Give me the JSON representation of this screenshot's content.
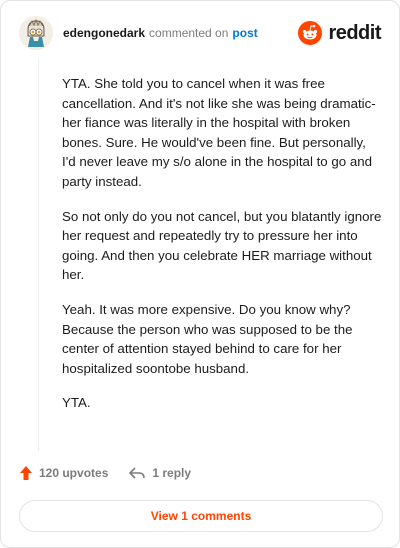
{
  "comment": {
    "username": "edengonedark",
    "commented_on_text": "commented on",
    "post_link_text": "post",
    "paragraphs": [
      "YTA. She told you to cancel when it was free cancellation. And it's not like she was being dramatic- her fiance was literally in the hospital with broken bones. Sure. He would've been fine. But personally, I'd never leave my s/o alone in the hospital to go and party instead.",
      "So not only do you not cancel, but you blatantly ignore her request and repeatedly try to pressure her into going. And then you celebrate HER marriage without her.",
      "Yeah. It was more expensive. Do you know why? Because the person who was supposed to be the center of attention stayed behind to care for her hospitalized soontobe husband.",
      "YTA."
    ],
    "upvotes_label": "120 upvotes",
    "reply_label": "1 reply",
    "view_comments_label": "View 1 comments"
  },
  "brand": {
    "name": "reddit",
    "accent": "#ff4500",
    "link_color": "#0079d3"
  },
  "icons": {
    "upvote": "upvote-arrow-icon",
    "reply": "reply-arrow-icon",
    "logo": "reddit-alien-icon"
  }
}
